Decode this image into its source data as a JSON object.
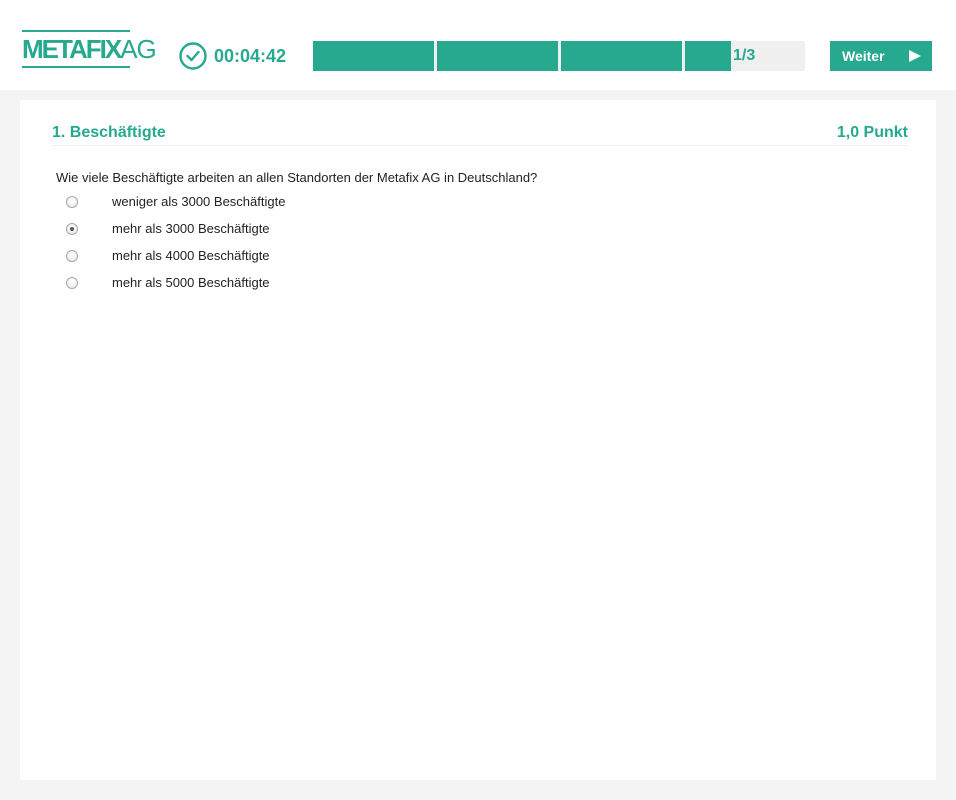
{
  "header": {
    "logo_main": "METAFIX",
    "logo_suffix": "AG",
    "timer": "00:04:42",
    "progress": {
      "label": "1/3",
      "segments_total": 4,
      "segments_filled": 4,
      "fill_fraction": 0.85
    },
    "next_label": "Weiter"
  },
  "question": {
    "title": "1. Beschäftigte",
    "points": "1,0 Punkt",
    "text": "Wie viele Beschäftigte arbeiten an allen Standorten der Metafix AG in Deutschland?",
    "options": [
      {
        "label": "weniger als 3000 Beschäftigte",
        "selected": false
      },
      {
        "label": "mehr als 3000 Beschäftigte",
        "selected": true
      },
      {
        "label": "mehr als 4000 Beschäftigte",
        "selected": false
      },
      {
        "label": "mehr als 5000 Beschäftigte",
        "selected": false
      }
    ]
  },
  "colors": {
    "accent": "#26a98f",
    "background": "#f4f4f4",
    "panel": "#ffffff",
    "text": "#222222"
  },
  "icons": {
    "timer": "clock-icon",
    "next": "play-triangle-icon"
  }
}
